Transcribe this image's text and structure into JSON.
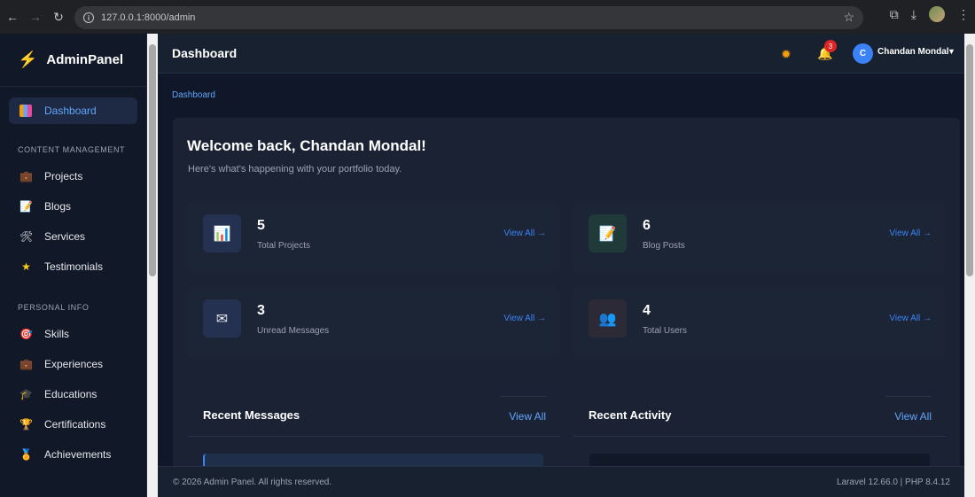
{
  "browser": {
    "url": "127.0.0.1:8000/admin"
  },
  "sidebar": {
    "brand": "AdminPanel",
    "active_item": "Dashboard",
    "sections": [
      {
        "title": "CONTENT MANAGEMENT",
        "items": [
          {
            "label": "Projects",
            "icon": "briefcase-icon"
          },
          {
            "label": "Blogs",
            "icon": "document-icon"
          },
          {
            "label": "Services",
            "icon": "tools-icon"
          },
          {
            "label": "Testimonials",
            "icon": "star-icon"
          }
        ]
      },
      {
        "title": "PERSONAL INFO",
        "items": [
          {
            "label": "Skills",
            "icon": "target-icon"
          },
          {
            "label": "Experiences",
            "icon": "briefcase-icon"
          },
          {
            "label": "Educations",
            "icon": "graduation-cap-icon"
          },
          {
            "label": "Certifications",
            "icon": "trophy-icon"
          },
          {
            "label": "Achievements",
            "icon": "medal-icon"
          }
        ]
      }
    ]
  },
  "header": {
    "title": "Dashboard",
    "notification_count": "3",
    "avatar_initial": "C",
    "user_name": "Chandan Mondal"
  },
  "breadcrumb": "Dashboard",
  "welcome": {
    "title": "Welcome back, Chandan Mondal!",
    "subtitle": "Here's what's happening with your portfolio today."
  },
  "stats": [
    {
      "value": "5",
      "label": "Total Projects",
      "link": "View All →",
      "icon": "chart-icon"
    },
    {
      "value": "6",
      "label": "Blog Posts",
      "link": "View All →",
      "icon": "document-pen-icon"
    },
    {
      "value": "3",
      "label": "Unread Messages",
      "link": "View All →",
      "icon": "envelope-icon"
    },
    {
      "value": "4",
      "label": "Total Users",
      "link": "View All →",
      "icon": "users-icon"
    }
  ],
  "panels": {
    "messages_title": "Recent Messages",
    "messages_link": "View All",
    "activity_title": "Recent Activity",
    "activity_link": "View All"
  },
  "footer": {
    "copyright": "© 2026 Admin Panel. All rights reserved.",
    "version": "Laravel 12.66.0 | PHP 8.4.12"
  },
  "colors": {
    "accent": "#3b82f6",
    "badge": "#dc2626",
    "brand_icon": "#f97316"
  }
}
